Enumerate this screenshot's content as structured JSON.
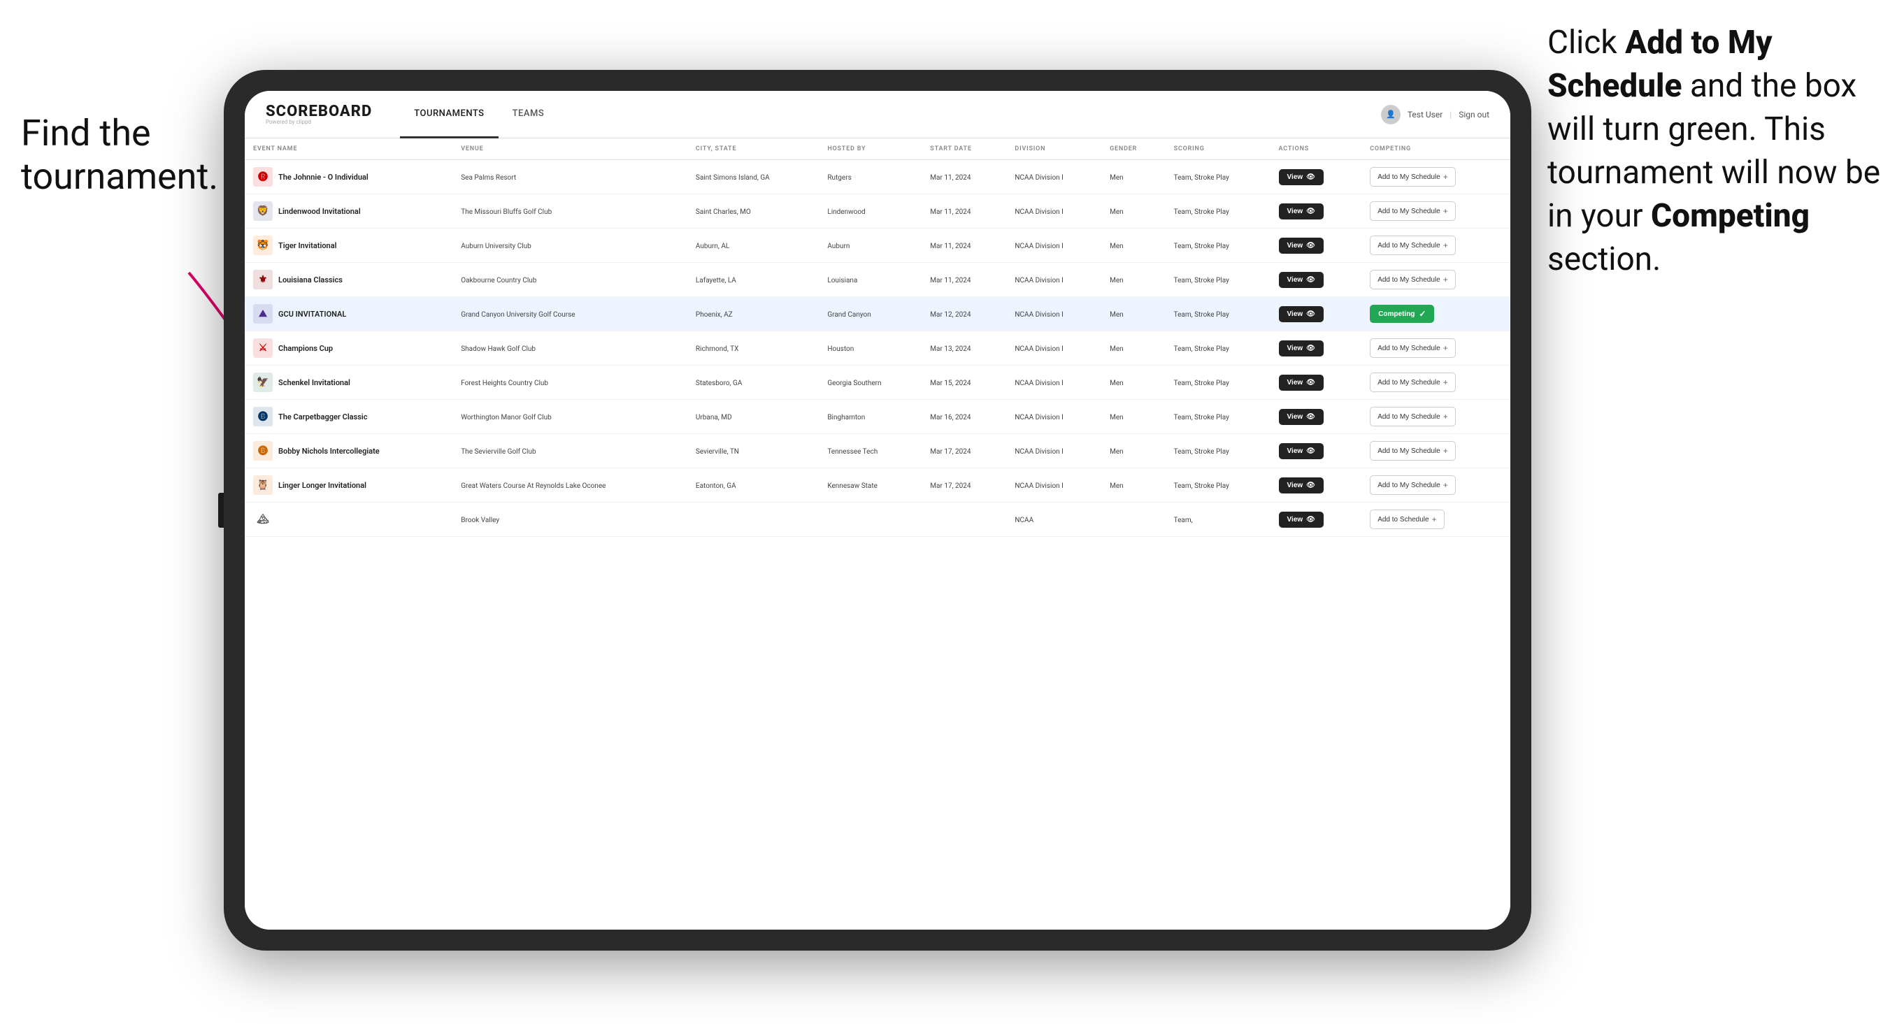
{
  "annotations": {
    "left_title": "Find the tournament.",
    "right_title": "Click Add to My Schedule and the box will turn green. This tournament will now be in your Competing section.",
    "right_bold1": "Add to My Schedule",
    "right_bold2": "Competing"
  },
  "header": {
    "logo": "SCOREBOARD",
    "logo_sub": "Powered by clippd",
    "nav": [
      "TOURNAMENTS",
      "TEAMS"
    ],
    "active_nav": "TOURNAMENTS",
    "user": "Test User",
    "sign_out": "Sign out"
  },
  "table": {
    "columns": [
      "EVENT NAME",
      "VENUE",
      "CITY, STATE",
      "HOSTED BY",
      "START DATE",
      "DIVISION",
      "GENDER",
      "SCORING",
      "ACTIONS",
      "COMPETING"
    ],
    "rows": [
      {
        "logo_emoji": "🅡",
        "logo_color": "#cc0000",
        "name": "The Johnnie - O Individual",
        "venue": "Sea Palms Resort",
        "city": "Saint Simons Island, GA",
        "hosted_by": "Rutgers",
        "start_date": "Mar 11, 2024",
        "division": "NCAA Division I",
        "gender": "Men",
        "scoring": "Team, Stroke Play",
        "action": "View",
        "competing": "Add to My Schedule",
        "is_competing": false,
        "highlighted": false
      },
      {
        "logo_emoji": "🦁",
        "logo_color": "#1a3a6b",
        "name": "Lindenwood Invitational",
        "venue": "The Missouri Bluffs Golf Club",
        "city": "Saint Charles, MO",
        "hosted_by": "Lindenwood",
        "start_date": "Mar 11, 2024",
        "division": "NCAA Division I",
        "gender": "Men",
        "scoring": "Team, Stroke Play",
        "action": "View",
        "competing": "Add to My Schedule",
        "is_competing": false,
        "highlighted": false
      },
      {
        "logo_emoji": "🐯",
        "logo_color": "#ff6600",
        "name": "Tiger Invitational",
        "venue": "Auburn University Club",
        "city": "Auburn, AL",
        "hosted_by": "Auburn",
        "start_date": "Mar 11, 2024",
        "division": "NCAA Division I",
        "gender": "Men",
        "scoring": "Team, Stroke Play",
        "action": "View",
        "competing": "Add to My Schedule",
        "is_competing": false,
        "highlighted": false
      },
      {
        "logo_emoji": "⚜",
        "logo_color": "#8b0000",
        "name": "Louisiana Classics",
        "venue": "Oakbourne Country Club",
        "city": "Lafayette, LA",
        "hosted_by": "Louisiana",
        "start_date": "Mar 11, 2024",
        "division": "NCAA Division I",
        "gender": "Men",
        "scoring": "Team, Stroke Play",
        "action": "View",
        "competing": "Add to My Schedule",
        "is_competing": false,
        "highlighted": false
      },
      {
        "logo_emoji": "⛰",
        "logo_color": "#4b2d8f",
        "name": "GCU INVITATIONAL",
        "venue": "Grand Canyon University Golf Course",
        "city": "Phoenix, AZ",
        "hosted_by": "Grand Canyon",
        "start_date": "Mar 12, 2024",
        "division": "NCAA Division I",
        "gender": "Men",
        "scoring": "Team, Stroke Play",
        "action": "View",
        "competing": "Competing",
        "is_competing": true,
        "highlighted": true
      },
      {
        "logo_emoji": "⚔",
        "logo_color": "#cc0000",
        "name": "Champions Cup",
        "venue": "Shadow Hawk Golf Club",
        "city": "Richmond, TX",
        "hosted_by": "Houston",
        "start_date": "Mar 13, 2024",
        "division": "NCAA Division I",
        "gender": "Men",
        "scoring": "Team, Stroke Play",
        "action": "View",
        "competing": "Add to My Schedule",
        "is_competing": false,
        "highlighted": false
      },
      {
        "logo_emoji": "🦅",
        "logo_color": "#006633",
        "name": "Schenkel Invitational",
        "venue": "Forest Heights Country Club",
        "city": "Statesboro, GA",
        "hosted_by": "Georgia Southern",
        "start_date": "Mar 15, 2024",
        "division": "NCAA Division I",
        "gender": "Men",
        "scoring": "Team, Stroke Play",
        "action": "View",
        "competing": "Add to My Schedule",
        "is_competing": false,
        "highlighted": false
      },
      {
        "logo_emoji": "🅑",
        "logo_color": "#003366",
        "name": "The Carpetbagger Classic",
        "venue": "Worthington Manor Golf Club",
        "city": "Urbana, MD",
        "hosted_by": "Binghamton",
        "start_date": "Mar 16, 2024",
        "division": "NCAA Division I",
        "gender": "Men",
        "scoring": "Team, Stroke Play",
        "action": "View",
        "competing": "Add to My Schedule",
        "is_competing": false,
        "highlighted": false
      },
      {
        "logo_emoji": "🅑",
        "logo_color": "#cc6600",
        "name": "Bobby Nichols Intercollegiate",
        "venue": "The Sevierville Golf Club",
        "city": "Sevierville, TN",
        "hosted_by": "Tennessee Tech",
        "start_date": "Mar 17, 2024",
        "division": "NCAA Division I",
        "gender": "Men",
        "scoring": "Team, Stroke Play",
        "action": "View",
        "competing": "Add to My Schedule",
        "is_competing": false,
        "highlighted": false
      },
      {
        "logo_emoji": "🦉",
        "logo_color": "#cc6600",
        "name": "Linger Longer Invitational",
        "venue": "Great Waters Course At Reynolds Lake Oconee",
        "city": "Eatonton, GA",
        "hosted_by": "Kennesaw State",
        "start_date": "Mar 17, 2024",
        "division": "NCAA Division I",
        "gender": "Men",
        "scoring": "Team, Stroke Play",
        "action": "View",
        "competing": "Add to My Schedule",
        "is_competing": false,
        "highlighted": false
      },
      {
        "logo_emoji": "🏔",
        "logo_color": "#555",
        "name": "",
        "venue": "Brook Valley",
        "city": "",
        "hosted_by": "",
        "start_date": "",
        "division": "NCAA",
        "gender": "",
        "scoring": "Team,",
        "action": "View",
        "competing": "Add to Schedule",
        "is_competing": false,
        "highlighted": false
      }
    ]
  }
}
